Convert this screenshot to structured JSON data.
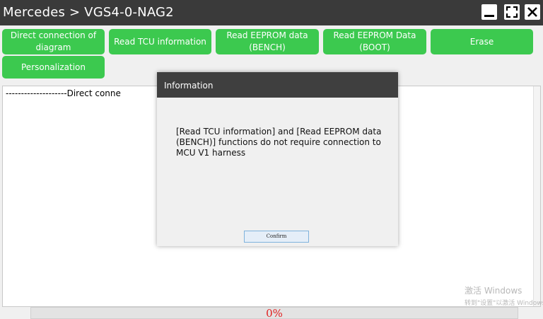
{
  "window": {
    "title": "Mercedes > VGS4-0-NAG2"
  },
  "toolbar": {
    "buttons": [
      {
        "label": "Direct connection of diagram"
      },
      {
        "label": "Read TCU information"
      },
      {
        "label": "Read EEPROM data (BENCH)"
      },
      {
        "label": "Read EEPROM Data (BOOT)"
      },
      {
        "label": "Erase"
      },
      {
        "label": "Personalization"
      }
    ]
  },
  "log": {
    "first_line": "--------------------Direct conne"
  },
  "progress": {
    "text": "0%",
    "value": 0
  },
  "watermark": {
    "line1": "激活 Windows",
    "line2": "转到\"设置\"以激活 Windows"
  },
  "dialog": {
    "title": "Information",
    "message": "[Read TCU information] and [Read EEPROM data (BENCH)] functions do not require connection to MCU V1 harness",
    "confirm_label": "Confirm"
  },
  "colors": {
    "accent_green": "#3cc94f",
    "titlebar": "#3a3a3a",
    "progress_text": "#e02020"
  }
}
